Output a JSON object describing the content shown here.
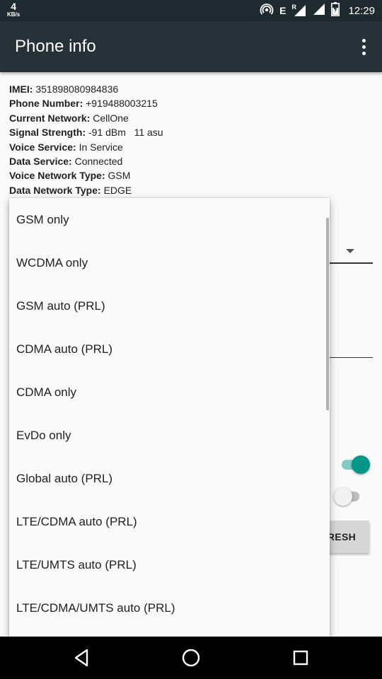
{
  "status_bar": {
    "speed_value": "4",
    "speed_unit": "KB/s",
    "network_type": "E",
    "roaming": "R",
    "time": "12:29"
  },
  "app_bar": {
    "title": "Phone info",
    "overflow_icon": "more-vert-icon"
  },
  "info": {
    "rows": [
      {
        "label": "IMEI:",
        "value": "351898080984836"
      },
      {
        "label": "Phone Number:",
        "value": "+919488003215"
      },
      {
        "label": "Current Network:",
        "value": "CellOne"
      },
      {
        "label": "Signal Strength:",
        "value": "-91 dBm   11 asu"
      },
      {
        "label": "Voice Service:",
        "value": "In Service"
      },
      {
        "label": "Data Service:",
        "value": "Connected"
      },
      {
        "label": "Voice Network Type:",
        "value": "GSM"
      },
      {
        "label": "Data Network Type:",
        "value": "EDGE"
      }
    ]
  },
  "popup": {
    "options": [
      "GSM only",
      "WCDMA only",
      "GSM auto (PRL)",
      "CDMA auto (PRL)",
      "CDMA only",
      "EvDo only",
      "Global auto (PRL)",
      "LTE/CDMA auto (PRL)",
      "LTE/UMTS auto (PRL)",
      "LTE/CDMA/UMTS auto (PRL)"
    ]
  },
  "background": {
    "refresh_label": "RESH",
    "toggle_1_on": true,
    "toggle_2_on": false
  },
  "colors": {
    "status_bar": "#1e2a30",
    "app_bar": "#263238",
    "accent": "#009688"
  }
}
